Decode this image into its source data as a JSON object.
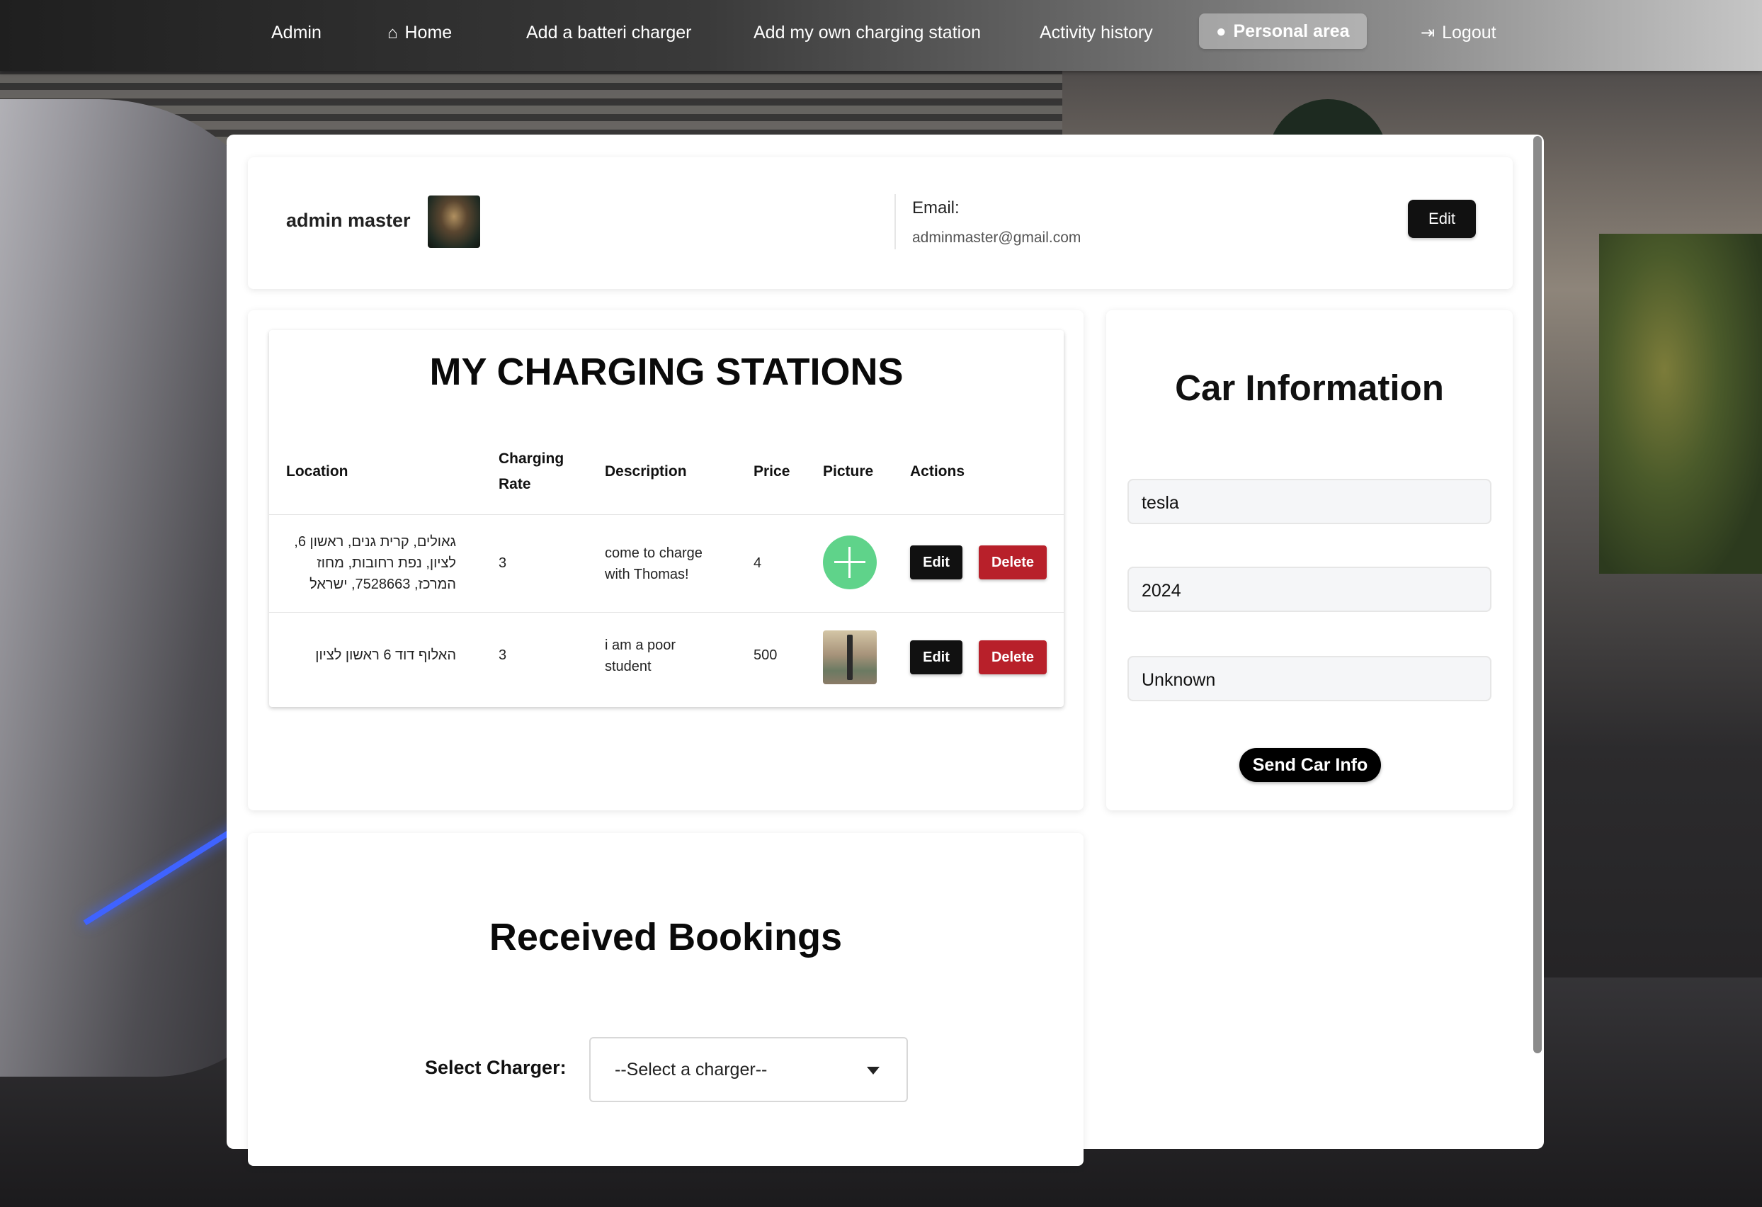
{
  "nav": {
    "items": [
      {
        "label": "Admin"
      },
      {
        "label": "Home",
        "icon": "home-icon"
      },
      {
        "label": "Add a batteri charger"
      },
      {
        "label": "Add my own charging station"
      },
      {
        "label": "Activity history"
      },
      {
        "label": "Personal area",
        "icon": "user-icon",
        "active": true
      },
      {
        "label": "Logout",
        "icon": "logout-icon"
      }
    ]
  },
  "profile": {
    "name": "admin master",
    "email_label": "Email:",
    "email": "adminmaster@gmail.com",
    "edit_label": "Edit"
  },
  "stations": {
    "title": "MY CHARGING STATIONS",
    "columns": [
      "Location",
      "Charging Rate",
      "Description",
      "Price",
      "Picture",
      "Actions"
    ],
    "rows": [
      {
        "location": "גאולים, קרית גנים, ראשון 6, לציון, נפת רחובות, מחוז המרכז, 7528663, ישראל",
        "rate": "3",
        "description": "come to charge with Thomas!",
        "price": "4",
        "picture": "plus-icon",
        "edit_label": "Edit",
        "delete_label": "Delete"
      },
      {
        "location": "האלוף דוד 6 ראשון לציון",
        "rate": "3",
        "description": "i am a poor student",
        "price": "500",
        "picture": "charger-photo",
        "edit_label": "Edit",
        "delete_label": "Delete"
      }
    ]
  },
  "car_info": {
    "title": "Car Information",
    "fields": [
      "tesla",
      "2024",
      "Unknown"
    ],
    "send_label": "Send Car Info"
  },
  "bookings": {
    "title": "Received Bookings",
    "select_label": "Select Charger:",
    "select_value": "--Select a charger--"
  },
  "colors": {
    "delete": "#b8202a",
    "plus_bg": "#5fd38a",
    "primary": "#111111"
  }
}
